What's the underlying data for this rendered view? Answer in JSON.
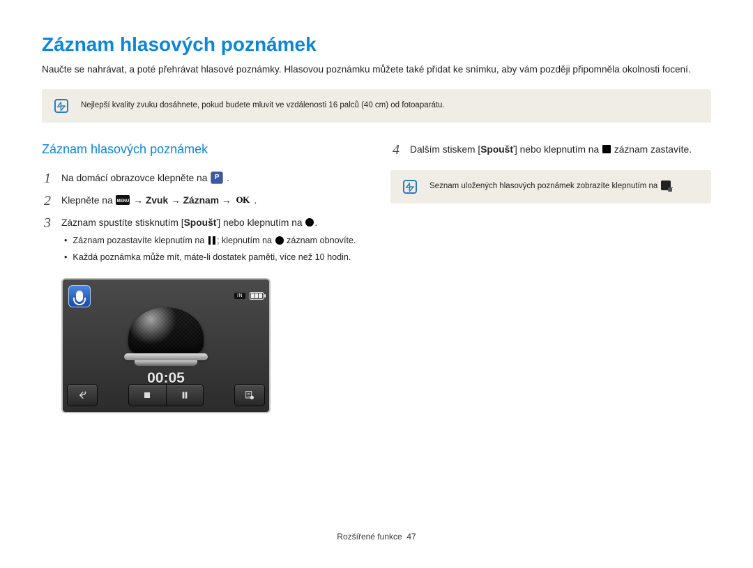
{
  "title": "Záznam hlasových poznámek",
  "intro": "Naučte se nahrávat, a poté přehrávat hlasové poznámky. Hlasovou poznámku můžete také přidat ke snímku, aby vám později připomněla okolnosti focení.",
  "tip1": "Nejlepší kvality zvuku dosáhnete, pokud budete mluvit ve vzdálenosti 16 palců (40 cm) od fotoaparátu.",
  "subtitle": "Záznam hlasových poznámek",
  "steps": {
    "s1_a": "Na domácí obrazovce klepněte na ",
    "s1_b": ".",
    "s2_a": "Klepněte na ",
    "s2_b": " → Zvuk → Záznam → ",
    "s2_c": ".",
    "s3_a": "Záznam spustíte stisknutím [",
    "s3_shutter": "Spoušť",
    "s3_b": "] nebo klepnutím na ",
    "s3_c": ".",
    "s3_sub1_a": "Záznam pozastavíte klepnutím na ",
    "s3_sub1_b": "; klepnutím na ",
    "s3_sub1_c": " záznam obnovíte.",
    "s3_sub2": "Každá poznámka může mít, máte-li dostatek paměti, více než 10 hodin.",
    "s4_a": "Dalším stiskem [",
    "s4_shutter": "Spoušť",
    "s4_b": "] nebo klepnutím na ",
    "s4_c": " záznam zastavíte.",
    "tip2_a": "Seznam uložených hlasových poznámek zobrazíte klepnutím na ",
    "tip2_b": "."
  },
  "preview": {
    "in_badge": "IN",
    "timer": "00:05",
    "icons": {
      "menu_label": "MENU",
      "ok_label": "OK"
    }
  },
  "footer_label": "Rozšířené funkce",
  "footer_page": "47"
}
